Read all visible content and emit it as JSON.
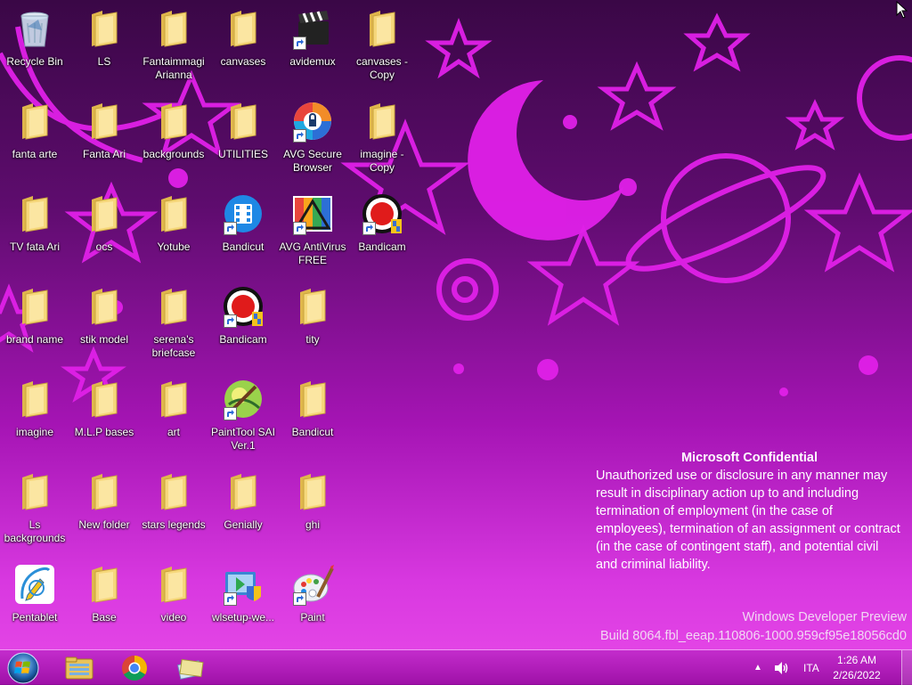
{
  "desktop": {
    "icons": [
      {
        "id": "recycle-bin",
        "label": "Recycle Bin"
      },
      {
        "id": "ls",
        "label": "LS"
      },
      {
        "id": "fantaimmagi-arianna",
        "label": "Fantaimmagi Arianna"
      },
      {
        "id": "canvases",
        "label": "canvases"
      },
      {
        "id": "avidemux",
        "label": "avidemux"
      },
      {
        "id": "canvases-copy",
        "label": "canvases - Copy"
      },
      {
        "id": "fanta-arte",
        "label": "fanta arte"
      },
      {
        "id": "fanta-ari",
        "label": "Fanta Ari"
      },
      {
        "id": "backgrounds",
        "label": "backgrounds"
      },
      {
        "id": "utilities",
        "label": "UTILITIES"
      },
      {
        "id": "avg-secure-browser",
        "label": "AVG Secure Browser"
      },
      {
        "id": "imagine-copy",
        "label": "imagine - Copy"
      },
      {
        "id": "tv-fata-ari",
        "label": "TV  fata Ari"
      },
      {
        "id": "ocs",
        "label": "ocs"
      },
      {
        "id": "yotube",
        "label": "Yotube"
      },
      {
        "id": "bandicut-1",
        "label": "Bandicut"
      },
      {
        "id": "avg-antivirus-free",
        "label": "AVG AntiVirus FREE"
      },
      {
        "id": "bandicam-1",
        "label": "Bandicam"
      },
      {
        "id": "brand-name",
        "label": "brand name"
      },
      {
        "id": "stik-model",
        "label": "stik  model"
      },
      {
        "id": "serenas-briefcase",
        "label": "serena's briefcase"
      },
      {
        "id": "bandicam-2",
        "label": "Bandicam"
      },
      {
        "id": "tity",
        "label": "tity"
      },
      {
        "id": "imagine",
        "label": "imagine"
      },
      {
        "id": "mlp-bases",
        "label": "M.L.P bases"
      },
      {
        "id": "art",
        "label": "art"
      },
      {
        "id": "painttool-sai",
        "label": "PaintTool SAI Ver.1"
      },
      {
        "id": "bandicut-2",
        "label": "Bandicut"
      },
      {
        "id": "ls-backgrounds",
        "label": "Ls backgrounds"
      },
      {
        "id": "new-folder",
        "label": "New folder"
      },
      {
        "id": "stars-legends",
        "label": "stars legends"
      },
      {
        "id": "genially",
        "label": "Genially"
      },
      {
        "id": "ghi",
        "label": "ghi"
      },
      {
        "id": "pentablet",
        "label": "Pentablet"
      },
      {
        "id": "base",
        "label": "Base"
      },
      {
        "id": "video",
        "label": "video"
      },
      {
        "id": "wlsetup",
        "label": "wlsetup-we..."
      },
      {
        "id": "paint",
        "label": "Paint"
      }
    ]
  },
  "watermark": {
    "title": "Microsoft Confidential",
    "body": "Unauthorized use or disclosure in any manner may result in disciplinary action up to and including termination of employment (in the case of employees), termination of an assignment or contract (in the case of contingent staff), and potential civil and criminal liability.",
    "product": "Windows Developer Preview",
    "build": "Build 8064.fbl_eeap.110806-1000.959cf95e18056cd0"
  },
  "taskbar": {
    "pinned": [
      "start-orb-icon",
      "file-explorer-icon",
      "chrome-icon",
      "libraries-icon"
    ],
    "tray": {
      "language": "ITA",
      "time": "1:26 AM",
      "date": "2/26/2022"
    }
  },
  "colors": {
    "wallpaper_top": "#3a0746",
    "wallpaper_bottom": "#e84ae8",
    "wallpaper_shapes": "#e020e8",
    "taskbar": "#b01cc0",
    "folder": "#f3d26e"
  }
}
